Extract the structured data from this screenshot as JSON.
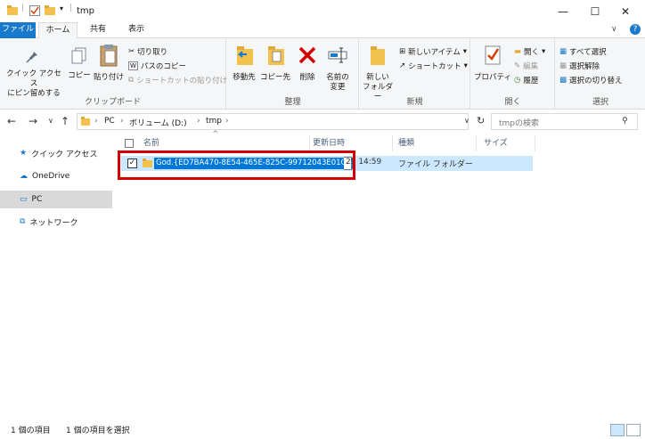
{
  "window": {
    "title": "tmp",
    "minimize_glyph": "—",
    "maximize_glyph": "☐",
    "close_glyph": "✕"
  },
  "tabs": {
    "file": "ファイル",
    "home": "ホーム",
    "share": "共有",
    "view": "表示"
  },
  "ribbon_controls": {
    "collapse": "∨",
    "help": "?"
  },
  "ribbon": {
    "clipboard": {
      "label": "クリップボード",
      "pin": "クイック アクセス\nにピン留めする",
      "copy": "コピー",
      "paste": "貼り付け",
      "cut": "切り取り",
      "copy_path": "パスのコピー",
      "paste_shortcut": "ショートカットの貼り付け"
    },
    "organize": {
      "label": "整理",
      "move_to": "移動先",
      "copy_to": "コピー先",
      "delete": "削除",
      "rename": "名前の\n変更"
    },
    "new": {
      "label": "新規",
      "new_folder": "新しい\nフォルダー",
      "new_item": "新しいアイテム",
      "shortcut": "ショートカット"
    },
    "open": {
      "label": "開く",
      "properties": "プロパティ",
      "open": "開く",
      "edit": "編集",
      "history": "履歴"
    },
    "select": {
      "label": "選択",
      "select_all": "すべて選択",
      "select_none": "選択解除",
      "invert": "選択の切り替え"
    }
  },
  "address": {
    "crumbs": [
      "PC",
      "ボリューム (D:)",
      "tmp"
    ],
    "search_placeholder": "tmpの検索"
  },
  "nav": {
    "items": [
      {
        "label": "クイック アクセス",
        "icon": "star-icon"
      },
      {
        "label": "OneDrive",
        "icon": "cloud-icon"
      },
      {
        "label": "PC",
        "icon": "pc-icon"
      },
      {
        "label": "ネットワーク",
        "icon": "network-icon"
      }
    ]
  },
  "columns": {
    "name": "名前",
    "modified": "更新日時",
    "type": "種類",
    "size": "サイズ"
  },
  "files": [
    {
      "name_edit": "God.{ED7BA470-8E54-465E-825C-99712043E01C}",
      "modified_partial": "29 14:59",
      "type": "ファイル フォルダー",
      "checked": true
    }
  ],
  "status": {
    "count": "1 個の項目",
    "selected": "1 個の項目を選択"
  },
  "colors": {
    "accent": "#1979ca",
    "selection": "#cce8ff",
    "highlight": "#0078d7",
    "annotation": "#d40000"
  }
}
